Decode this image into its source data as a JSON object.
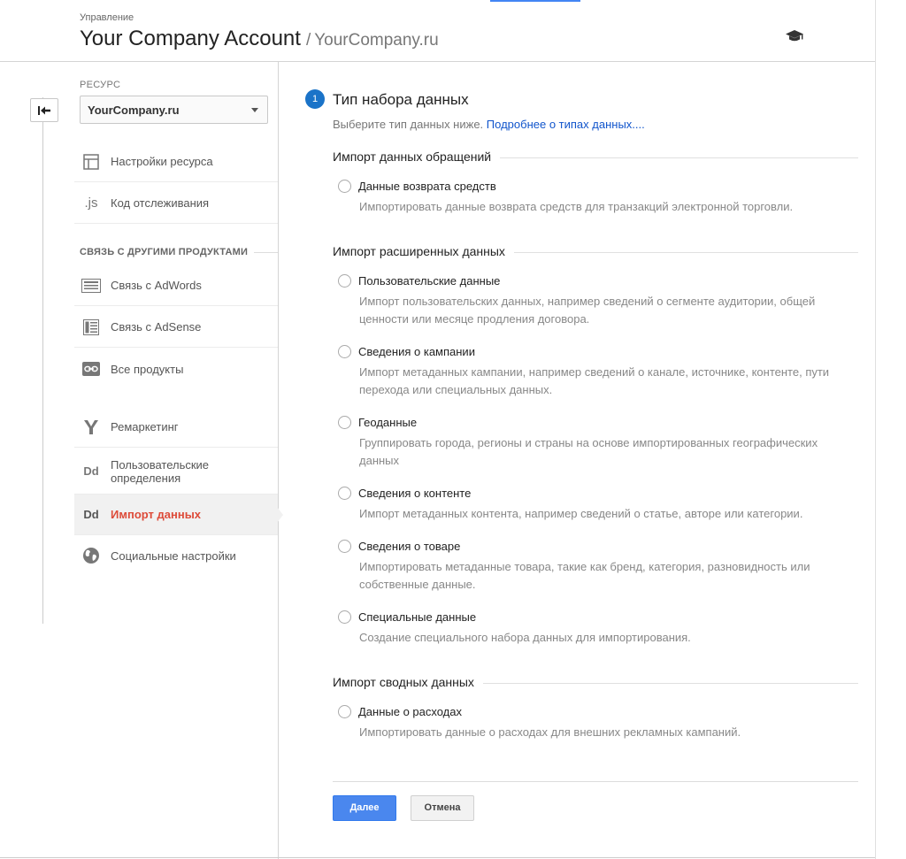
{
  "header": {
    "breadcrumb": "Управление",
    "account": "Your Company Account",
    "separator": "/",
    "property": "YourCompany.ru"
  },
  "sidebar": {
    "resource_label": "РЕСУРС",
    "resource_value": "YourCompany.ru",
    "items_top": [
      {
        "label": "Настройки ресурса",
        "icon": "property-settings-icon"
      },
      {
        "label": "Код отслеживания",
        "icon": "js-icon",
        "glyph": ".js"
      }
    ],
    "section_label": "СВЯЗЬ С ДРУГИМИ ПРОДУКТАМИ",
    "items_links": [
      {
        "label": "Связь с AdWords",
        "icon": "adwords-icon"
      },
      {
        "label": "Связь с AdSense",
        "icon": "adsense-icon"
      },
      {
        "label": "Все продукты",
        "icon": "link-icon"
      }
    ],
    "items_bottom": [
      {
        "label": "Ремаркетинг",
        "icon": "remarketing-icon"
      },
      {
        "label": "Пользовательские определения",
        "icon": "dd-icon",
        "glyph": "Dd"
      },
      {
        "label": "Импорт данных",
        "icon": "dd-icon",
        "glyph": "Dd",
        "active": true
      },
      {
        "label": "Социальные настройки",
        "icon": "globe-icon"
      }
    ]
  },
  "main": {
    "step_number": "1",
    "step_title": "Тип набора данных",
    "step_desc": "Выберите тип данных ниже.",
    "step_link": "Подробнее о типах данных....",
    "groups": [
      {
        "title": "Импорт данных обращений",
        "options": [
          {
            "label": "Данные возврата средств",
            "desc": "Импортировать данные возврата средств для транзакций электронной торговли."
          }
        ]
      },
      {
        "title": "Импорт расширенных данных",
        "options": [
          {
            "label": "Пользовательские данные",
            "desc": "Импорт пользовательских данных, например сведений о сегменте аудитории, общей ценности или месяце продления договора."
          },
          {
            "label": "Сведения о кампании",
            "desc": "Импорт метаданных кампании, например сведений о канале, источнике, контенте, пути перехода или специальных данных."
          },
          {
            "label": "Геоданные",
            "desc": "Группировать города, регионы и страны на основе импортированных географических данных"
          },
          {
            "label": "Сведения о контенте",
            "desc": "Импорт метаданных контента, например сведений о статье, авторе или категории."
          },
          {
            "label": "Сведения о товаре",
            "desc": "Импортировать метаданные товара, такие как бренд, категория, разновидность или собственные данные."
          },
          {
            "label": "Специальные данные",
            "desc": "Создание специального набора данных для импортирования."
          }
        ]
      },
      {
        "title": "Импорт сводных данных",
        "options": [
          {
            "label": "Данные о расходах",
            "desc": "Импортировать данные о расходах для внешних рекламных кампаний."
          }
        ]
      }
    ],
    "buttons": {
      "next": "Далее",
      "cancel": "Отмена"
    }
  },
  "colors": {
    "accent": "#4285f4",
    "step_circle": "#1a73c8",
    "active_nav": "#dd4b39",
    "link": "#1155cc"
  }
}
